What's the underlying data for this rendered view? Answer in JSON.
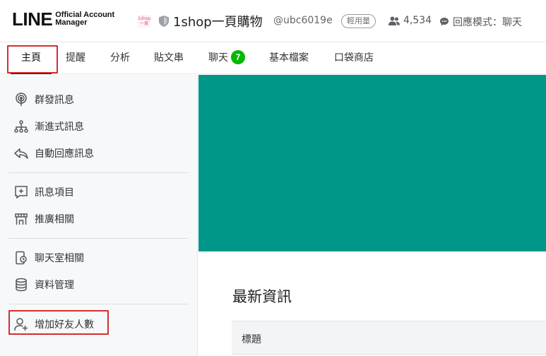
{
  "header": {
    "logo_main": "LINE",
    "logo_sub_1": "Official Account",
    "logo_sub_2": "Manager",
    "account_thumb_text": "1shop 一頁",
    "account_name": "1shop一頁購物",
    "account_id": "@ubc6019e",
    "plan_badge": "輕用量",
    "friend_count": "4,534",
    "response_mode": "回應模式：聊天",
    "icons": {
      "shield": "shield-icon",
      "friends": "users-icon",
      "mode": "chat-bubble-icon"
    }
  },
  "tabs": [
    {
      "label": "主頁",
      "active": true
    },
    {
      "label": "提醒"
    },
    {
      "label": "分析"
    },
    {
      "label": "貼文串"
    },
    {
      "label": "聊天",
      "badge": "7"
    },
    {
      "label": "基本檔案"
    },
    {
      "label": "口袋商店"
    }
  ],
  "sidebar": {
    "items": [
      {
        "label": "群發訊息",
        "icon": "broadcast-icon"
      },
      {
        "label": "漸進式訊息",
        "icon": "hierarchy-icon"
      },
      {
        "label": "自動回應訊息",
        "icon": "reply-icon"
      },
      {
        "label": "訊息項目",
        "icon": "message-add-icon"
      },
      {
        "label": "推廣相關",
        "icon": "storefront-icon"
      },
      {
        "label": "聊天室相關",
        "icon": "chat-room-icon"
      },
      {
        "label": "資料管理",
        "icon": "database-icon"
      },
      {
        "label": "增加好友人數",
        "icon": "add-friend-icon"
      }
    ]
  },
  "main": {
    "banner_color": "#009688",
    "news_title": "最新資訊",
    "table_header": "標題"
  },
  "colors": {
    "accent_green": "#00b900",
    "highlight_red": "#d32f2f",
    "banner_teal": "#009688"
  }
}
